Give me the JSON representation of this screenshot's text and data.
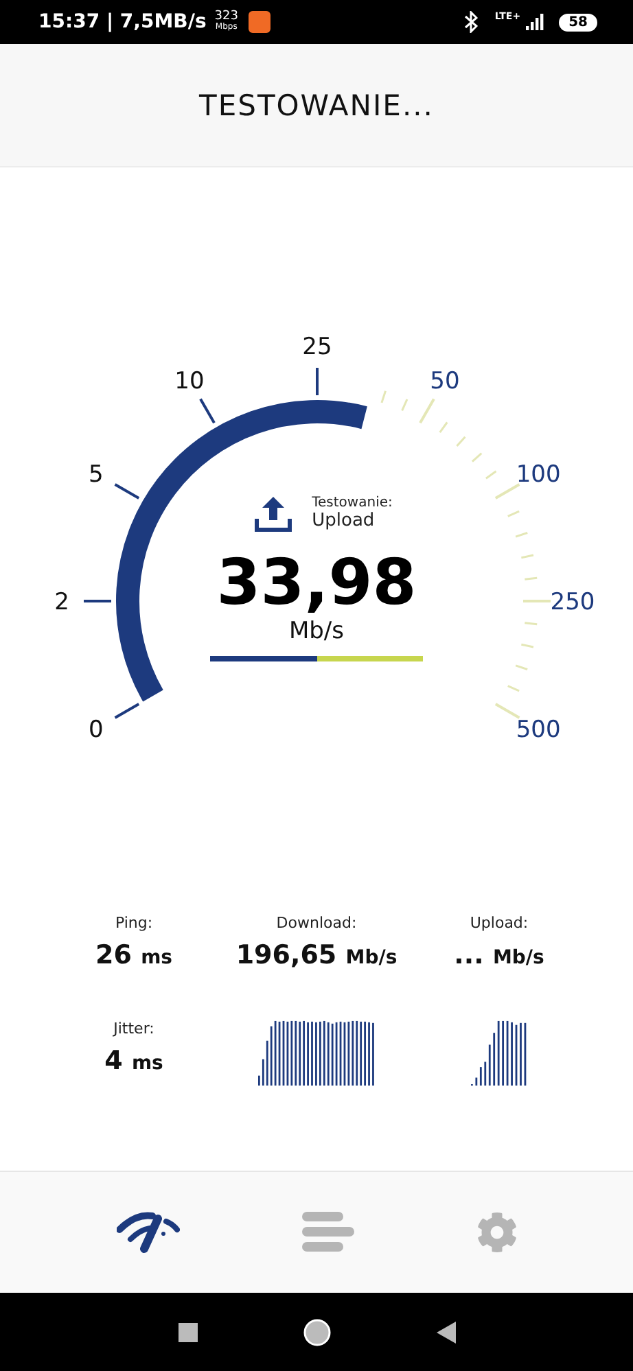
{
  "status_bar": {
    "time": "15:37 | 7,5MB/s",
    "rate_value": "323",
    "rate_unit": "Mbps",
    "network": "LTE+",
    "battery": "58"
  },
  "header": {
    "title": "TESTOWANIE..."
  },
  "gauge": {
    "scale": [
      {
        "label": "0",
        "passed": true
      },
      {
        "label": "2",
        "passed": true
      },
      {
        "label": "5",
        "passed": true
      },
      {
        "label": "10",
        "passed": true
      },
      {
        "label": "25",
        "passed": true
      },
      {
        "label": "50",
        "passed": false
      },
      {
        "label": "100",
        "passed": false
      },
      {
        "label": "250",
        "passed": false
      },
      {
        "label": "500",
        "passed": false
      }
    ],
    "status_label": "Testowanie:",
    "status_value": "Upload",
    "value": "33,98",
    "unit": "Mb/s",
    "progress": {
      "level": 0.5
    }
  },
  "stats": [
    {
      "label": "Ping:",
      "value": "26",
      "unit": "ms"
    },
    {
      "label": "Download:",
      "value": "196,65",
      "unit": "Mb/s"
    },
    {
      "label": "Upload:",
      "value": "...",
      "unit": "Mb/s"
    },
    {
      "label": "Jitter:",
      "value": "4",
      "unit": "ms"
    }
  ],
  "nav": [
    {
      "kind": "speed",
      "selected": true
    },
    {
      "kind": "results",
      "selected": false
    },
    {
      "kind": "settings",
      "selected": false
    }
  ]
}
